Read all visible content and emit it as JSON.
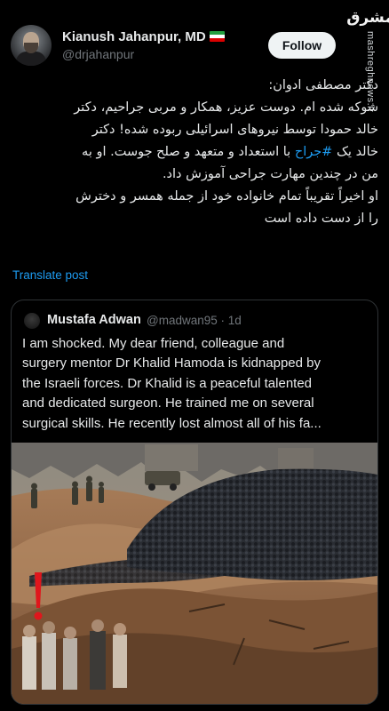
{
  "watermark": {
    "logo": "مشرق",
    "url": "mashreghnews.ir"
  },
  "tweet": {
    "author_name": "Kianush Jahanpur, MD",
    "author_handle": "@drjahanpur",
    "follow_label": "Follow",
    "text_lines": [
      "دکتر مصطفی ادوان:",
      "شوکه شده ام. دوست عزیز، همکار و مربی جراحیم، دکتر",
      "خالد حمودا توسط نیروهای اسرائیلی ربوده شده! دکتر",
      "خالد یک",
      "#جراح",
      "با استعداد و متعهد و صلح جوست. او به",
      "من در چندین مهارت جراحی آموزش داد.",
      "او اخیراً تقریباً تمام خانواده خود از جمله همسر و دخترش",
      "را از دست داده است"
    ],
    "translate_label": "Translate post"
  },
  "quote": {
    "author_name": "Mustafa Adwan",
    "author_handle": "@madwan95",
    "separator": "·",
    "time": "1d",
    "text": "I am shocked. My dear friend, colleague and\nsurgery mentor Dr Khalid Hamoda is kidnapped by\nthe Israeli forces. Dr Khalid is a peaceful talented\nand dedicated surgeon. He trained me on several\nsurgical skills. He recently lost almost all of his fa..."
  },
  "colors": {
    "background": "#000000",
    "text": "#e7e9ea",
    "secondary": "#71767b",
    "link": "#1d9bf0",
    "border": "#2f3336",
    "follow_bg": "#eff3f4",
    "alert": "#e0161c"
  },
  "icons": {
    "flag": "iran-flag-icon",
    "alert": "exclamation-mark-icon"
  }
}
